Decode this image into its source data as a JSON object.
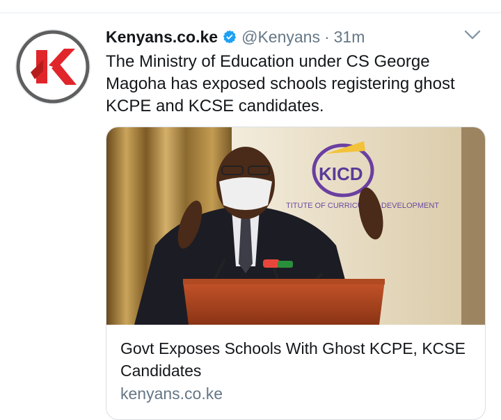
{
  "tweet": {
    "display_name": "Kenyans.co.ke",
    "handle": "@Kenyans",
    "separator": "·",
    "time": "31m",
    "text": "The Ministry of Education under CS George Magoha has exposed schools registering ghost KCPE and KCSE candidates.",
    "avatar_letter": "K"
  },
  "card": {
    "image_banner_logo": "KICD",
    "image_banner_text": "TITUTE OF CURRICULUM DEVELOPMENT",
    "title": "Govt Exposes Schools With Ghost KCPE, KCSE Candidates",
    "domain": "kenyans.co.ke"
  },
  "icons": {
    "verified": "verified-badge-icon",
    "menu": "chevron-down-icon"
  },
  "colors": {
    "brand_red": "#e0252b",
    "verified_blue": "#1da1f2",
    "secondary_text": "#657786"
  }
}
